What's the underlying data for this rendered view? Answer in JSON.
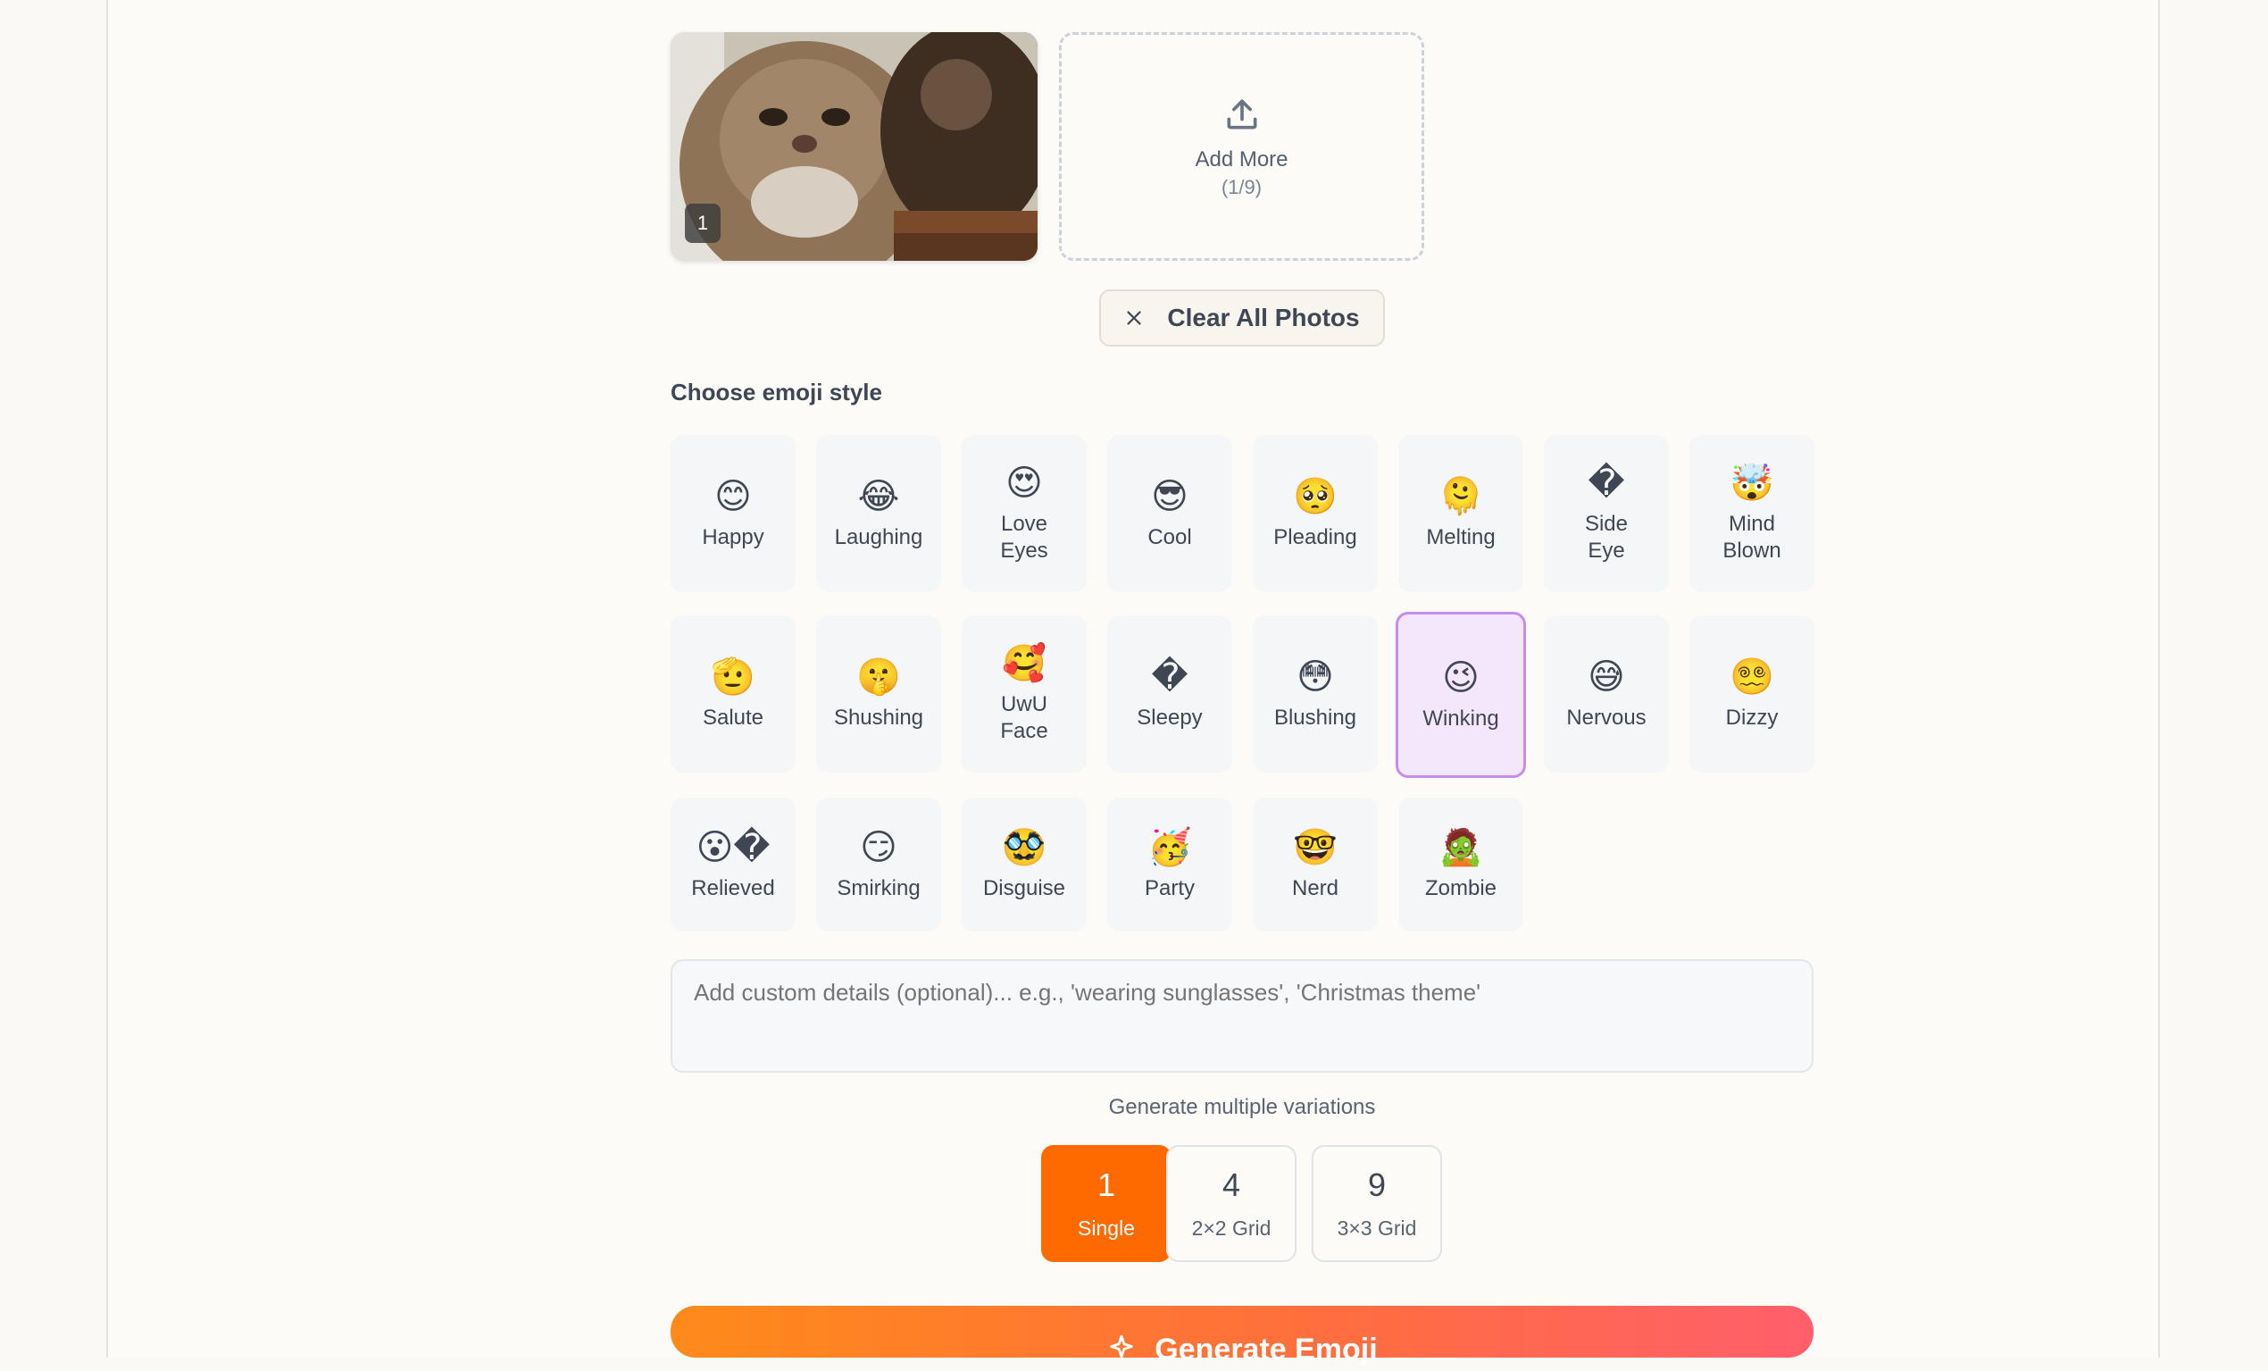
{
  "photos": {
    "items": [
      {
        "badge": "1"
      }
    ],
    "add_more_label": "Add More",
    "add_more_count": "(1/9)",
    "clear_label": "Clear All Photos"
  },
  "style_section": {
    "title": "Choose emoji style",
    "selected": "Winking",
    "styles": [
      {
        "emoji": "😊",
        "label": "Happy"
      },
      {
        "emoji": "😂",
        "label": "Laughing"
      },
      {
        "emoji": "😍",
        "label": "Love Eyes"
      },
      {
        "emoji": "😎",
        "label": "Cool"
      },
      {
        "emoji": "🥺",
        "label": "Pleading"
      },
      {
        "emoji": "🫠",
        "label": "Melting"
      },
      {
        "emoji": "�",
        "label": "Side Eye"
      },
      {
        "emoji": "🤯",
        "label": "Mind Blown"
      },
      {
        "emoji": "🫡",
        "label": "Salute"
      },
      {
        "emoji": "🤫",
        "label": "Shushing"
      },
      {
        "emoji": "🥰",
        "label": "UwU Face"
      },
      {
        "emoji": "�",
        "label": "Sleepy"
      },
      {
        "emoji": "😳",
        "label": "Blushing"
      },
      {
        "emoji": "😉",
        "label": "Winking"
      },
      {
        "emoji": "😅",
        "label": "Nervous"
      },
      {
        "emoji": "😵‍💫",
        "label": "Dizzy"
      },
      {
        "emoji": "😮�",
        "label": "Relieved"
      },
      {
        "emoji": "😏",
        "label": "Smirking"
      },
      {
        "emoji": "🥸",
        "label": "Disguise"
      },
      {
        "emoji": "🥳",
        "label": "Party"
      },
      {
        "emoji": "🤓",
        "label": "Nerd"
      },
      {
        "emoji": "🧟",
        "label": "Zombie"
      }
    ]
  },
  "custom_details": {
    "placeholder": "Add custom details (optional)... e.g., 'wearing sunglasses', 'Christmas theme'",
    "value": ""
  },
  "variations": {
    "label": "Generate multiple variations",
    "options": [
      {
        "count": "1",
        "label": "Single",
        "active": true
      },
      {
        "count": "4",
        "label": "2×2 Grid",
        "active": false
      },
      {
        "count": "9",
        "label": "3×3 Grid",
        "active": false
      }
    ]
  },
  "generate": {
    "label": "Generate Emoji"
  },
  "colors": {
    "accent": "#ff6a00",
    "selected_border": "#c78cf0",
    "selected_bg": "#f5e7fb"
  }
}
